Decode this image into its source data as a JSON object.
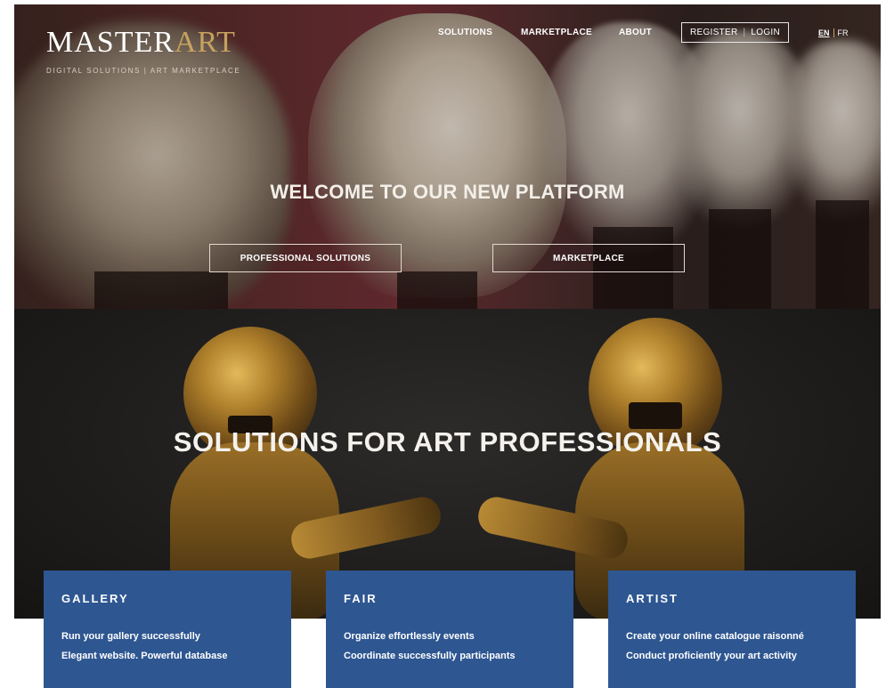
{
  "logo": {
    "main_prefix": "MASTER",
    "main_accent": "ART",
    "subtitle": "DIGITAL SOLUTIONS | ART MARKETPLACE",
    "accent_color": "#c7a25f"
  },
  "nav": {
    "solutions": "SOLUTIONS",
    "marketplace": "MARKETPLACE",
    "about": "ABOUT",
    "register": "REGISTER",
    "auth_separator": "|",
    "login": "LOGIN",
    "lang_en": "EN",
    "lang_fr": "FR"
  },
  "hero": {
    "title": "WELCOME TO OUR NEW PLATFORM",
    "button_professional": "PROFESSIONAL SOLUTIONS",
    "button_marketplace": "MARKETPLACE"
  },
  "solutions": {
    "title": "SOLUTIONS FOR ART PROFESSIONALS",
    "cards": [
      {
        "title": "GALLERY",
        "line1": "Run your gallery successfully",
        "line2": "Elegant website. Powerful database"
      },
      {
        "title": "FAIR",
        "line1": "Organize effortlessly events",
        "line2": "Coordinate successfully participants"
      },
      {
        "title": "ARTIST",
        "line1": "Create your online catalogue raisonné",
        "line2": "Conduct proficiently your art activity"
      }
    ],
    "card_color": "#2e5691"
  }
}
